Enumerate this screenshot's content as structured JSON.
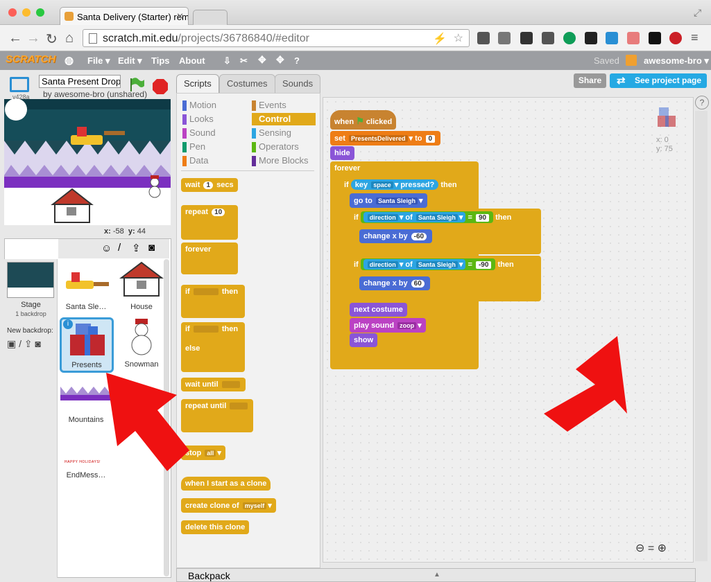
{
  "browser": {
    "tab_title": "Santa Delivery (Starter) rem",
    "url_host": "scratch.mit.edu",
    "url_path": "/projects/36786840/#editor"
  },
  "menu": {
    "logo": "SCRATCH",
    "items": [
      "File ▾",
      "Edit ▾",
      "Tips",
      "About"
    ],
    "saved": "Saved",
    "user": "awesome-bro ▾"
  },
  "stage": {
    "version": "v428a",
    "project_title": "Santa Present Drop",
    "byline": "by awesome-bro (unshared)",
    "x_label": "x:",
    "x_value": "-58",
    "y_label": "y:",
    "y_value": "44"
  },
  "sprite_pane": {
    "stage_label": "Stage",
    "backdrop_count": "1 backdrop",
    "new_backdrop": "New backdrop:",
    "sprites": [
      "Santa Sle…",
      "House",
      "Presents",
      "Snowman",
      "Mountains",
      "EndMess…"
    ],
    "end_message_text": "HAPPY HOLIDAYS!"
  },
  "editor_tabs": [
    "Scripts",
    "Costumes",
    "Sounds"
  ],
  "buttons": {
    "share": "Share",
    "see_project": "See project page"
  },
  "categories": [
    {
      "name": "Motion",
      "color": "#4a6cd4"
    },
    {
      "name": "Events",
      "color": "#c88330"
    },
    {
      "name": "Looks",
      "color": "#8a55d7"
    },
    {
      "name": "Control",
      "color": "#e1a91a"
    },
    {
      "name": "Sound",
      "color": "#bb42c3"
    },
    {
      "name": "Sensing",
      "color": "#2ca5e2"
    },
    {
      "name": "Pen",
      "color": "#0e9a6c"
    },
    {
      "name": "Operators",
      "color": "#5cb712"
    },
    {
      "name": "Data",
      "color": "#ee7d16"
    },
    {
      "name": "More Blocks",
      "color": "#632d99"
    }
  ],
  "palette": {
    "wait": "wait",
    "wait_val": "1",
    "secs": "secs",
    "repeat": "repeat",
    "repeat_val": "10",
    "forever": "forever",
    "if": "if",
    "then": "then",
    "else": "else",
    "wait_until": "wait until",
    "repeat_until": "repeat until",
    "stop": "stop",
    "stop_opt": "all",
    "clone_start": "when I start as a clone",
    "create_clone": "create clone of",
    "clone_opt": "myself",
    "delete_clone": "delete this clone"
  },
  "script": {
    "when": "when",
    "clicked": "clicked",
    "set": "set",
    "var": "PresentsDelivered",
    "to": "to",
    "set_val": "0",
    "hide": "hide",
    "forever": "forever",
    "if": "if",
    "key": "key",
    "key_opt": "space",
    "pressed": "pressed?",
    "then": "then",
    "goto": "go to",
    "goto_opt": "Santa Sleigh",
    "direction": "direction",
    "of": "of",
    "sleigh": "Santa Sleigh",
    "eq": "=",
    "dir1": "90",
    "dir2": "-90",
    "change_x": "change x by",
    "cx1": "-60",
    "cx2": "60",
    "next_costume": "next costume",
    "play_sound": "play sound",
    "sound_opt": "zoop",
    "show": "show"
  },
  "sprite_info": {
    "x": "x: 0",
    "y": "y: 75"
  },
  "backpack": "Backpack"
}
